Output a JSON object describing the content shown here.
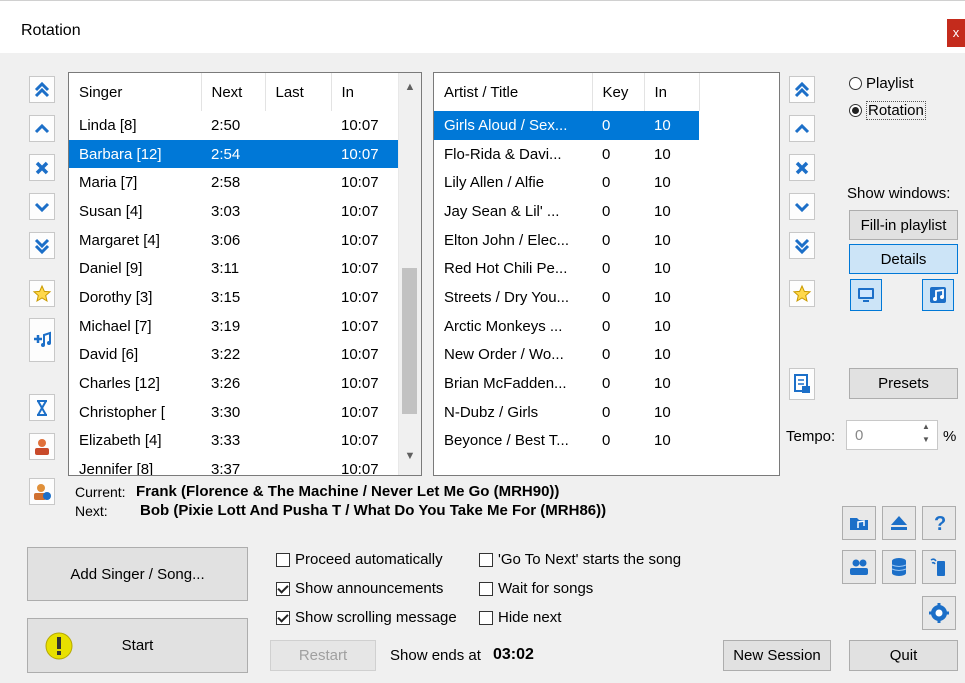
{
  "window": {
    "title": "Rotation",
    "close_glyph": "x"
  },
  "singers": {
    "columns": [
      "Singer",
      "Next",
      "Last",
      "In"
    ],
    "rows": [
      [
        "Linda [8]",
        "2:50",
        "",
        "10:07"
      ],
      [
        "Barbara [12]",
        "2:54",
        "",
        "10:07"
      ],
      [
        "Maria [7]",
        "2:58",
        "",
        "10:07"
      ],
      [
        "Susan [4]",
        "3:03",
        "",
        "10:07"
      ],
      [
        "Margaret [4]",
        "3:06",
        "",
        "10:07"
      ],
      [
        "Daniel [9]",
        "3:11",
        "",
        "10:07"
      ],
      [
        "Dorothy [3]",
        "3:15",
        "",
        "10:07"
      ],
      [
        "Michael [7]",
        "3:19",
        "",
        "10:07"
      ],
      [
        "David [6]",
        "3:22",
        "",
        "10:07"
      ],
      [
        "Charles [12]",
        "3:26",
        "",
        "10:07"
      ],
      [
        "Christopher [",
        "3:30",
        "",
        "10:07"
      ],
      [
        "Elizabeth [4]",
        "3:33",
        "",
        "10:07"
      ],
      [
        "Jennifer [8]",
        "3:37",
        "",
        "10:07"
      ]
    ],
    "selected_index": 1
  },
  "songs": {
    "columns": [
      "Artist / Title",
      "Key",
      "In"
    ],
    "rows": [
      [
        "Girls Aloud / Sex...",
        "0",
        "10"
      ],
      [
        "Flo-Rida & Davi...",
        "0",
        "10"
      ],
      [
        "Lily Allen / Alfie",
        "0",
        "10"
      ],
      [
        "Jay Sean & Lil' ...",
        "0",
        "10"
      ],
      [
        "Elton John / Elec...",
        "0",
        "10"
      ],
      [
        "Red Hot Chili Pe...",
        "0",
        "10"
      ],
      [
        "Streets / Dry You...",
        "0",
        "10"
      ],
      [
        "Arctic Monkeys ...",
        "0",
        "10"
      ],
      [
        "New Order / Wo...",
        "0",
        "10"
      ],
      [
        "Brian McFadden...",
        "0",
        "10"
      ],
      [
        "N-Dubz / Girls",
        "0",
        "10"
      ],
      [
        "Beyonce / Best T...",
        "0",
        "10"
      ]
    ],
    "selected_index": 0
  },
  "mode": {
    "playlist_label": "Playlist",
    "rotation_label": "Rotation",
    "selected": "Rotation"
  },
  "show_windows": {
    "label": "Show windows:",
    "fill_in_label": "Fill-in playlist",
    "details_label": "Details"
  },
  "presets_label": "Presets",
  "tempo": {
    "label": "Tempo:",
    "value": "0",
    "unit": "%"
  },
  "now": {
    "current_label": "Current:",
    "current_value": "Frank (Florence & The Machine / Never Let Me Go (MRH90))",
    "next_label": "Next:",
    "next_value": "Bob (Pixie Lott And Pusha T / What Do You Take Me For (MRH86))"
  },
  "buttons": {
    "add_singer": "Add Singer / Song...",
    "start": "Start",
    "restart": "Restart",
    "new_session": "New Session",
    "quit": "Quit"
  },
  "options": {
    "proceed_automatically": {
      "label": "Proceed automatically",
      "checked": false
    },
    "show_announcements": {
      "label": "Show announcements",
      "checked": true
    },
    "show_scrolling_message": {
      "label": "Show scrolling message",
      "checked": true
    },
    "go_to_next": {
      "label": "'Go To Next' starts the song",
      "checked": false
    },
    "wait_for_songs": {
      "label": "Wait for songs",
      "checked": false
    },
    "hide_next": {
      "label": "Hide next",
      "checked": false
    }
  },
  "show_ends": {
    "label": "Show ends at",
    "time": "03:02"
  },
  "colors": {
    "selection": "#0078d7",
    "icon_blue": "#1c6fc8",
    "highlight_button": "#cce4f7"
  }
}
